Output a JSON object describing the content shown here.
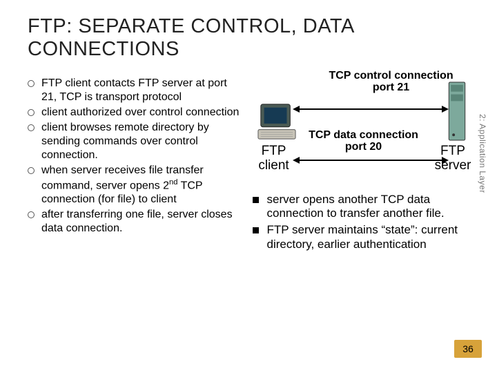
{
  "title": "FTP: SEPARATE CONTROL, DATA CONNECTIONS",
  "left_bullets": [
    "FTP client contacts FTP server at port 21, TCP is transport protocol",
    "client authorized over control connection",
    "client browses remote directory by sending commands over control connection.",
    "when server receives  file transfer command, server opens 2nd TCP connection (for file) to client",
    "after transferring one file, server closes data connection."
  ],
  "diagram": {
    "ctrl_line1": "TCP control connection",
    "ctrl_line2": "port 21",
    "data_line1": "TCP data connection",
    "data_line2": "port 20",
    "client_label": "FTP client",
    "server_label": "FTP server"
  },
  "right_bullets": [
    "server opens another TCP data connection to transfer another file.",
    "FTP server maintains “state”: current directory, earlier authentication"
  ],
  "side_label": "2: Application Layer",
  "page_number": "36"
}
